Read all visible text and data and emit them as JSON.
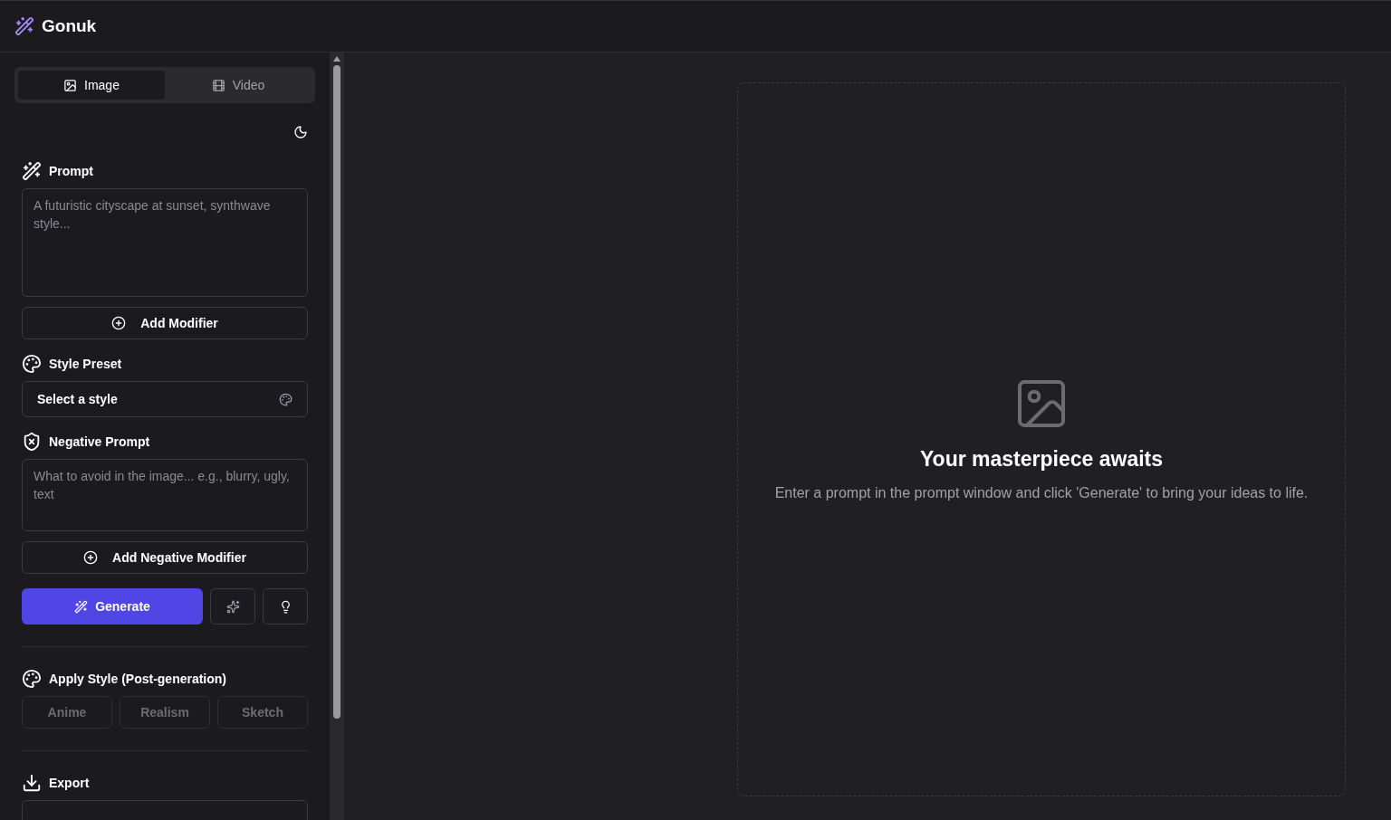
{
  "app": {
    "name": "Gonuk"
  },
  "tabs": [
    {
      "label": "Image",
      "kind": "image",
      "selected": true
    },
    {
      "label": "Video",
      "kind": "video",
      "selected": false
    }
  ],
  "prompt": {
    "label": "Prompt",
    "placeholder": "A futuristic cityscape at sunset, synthwave style...",
    "add_button": "Add Modifier"
  },
  "style_preset": {
    "label": "Style Preset",
    "value": "Select a style"
  },
  "negative_prompt": {
    "label": "Negative Prompt",
    "placeholder": "What to avoid in the image... e.g., blurry, ugly, text",
    "add_button": "Add Negative Modifier"
  },
  "generate_button": "Generate",
  "apply_style": {
    "label": "Apply Style (Post-generation)",
    "options": [
      {
        "label": "Anime",
        "disabled": true
      },
      {
        "label": "Realism",
        "disabled": true
      },
      {
        "label": "Sketch",
        "disabled": true
      }
    ]
  },
  "export": {
    "label": "Export"
  },
  "empty_state": {
    "title": "Your masterpiece awaits",
    "text": "Enter a prompt in the prompt window and click 'Generate' to bring your ideas to life."
  }
}
